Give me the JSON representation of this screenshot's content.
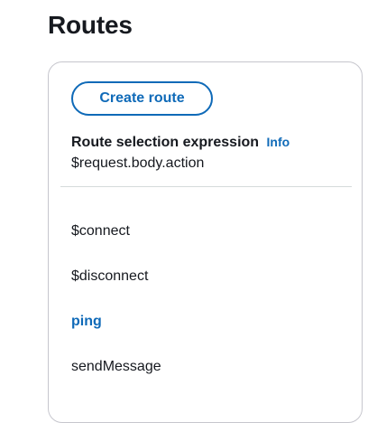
{
  "page": {
    "title": "Routes"
  },
  "panel": {
    "create_button_label": "Create route",
    "route_selection": {
      "label": "Route selection expression",
      "info_link": "Info",
      "value": "$request.body.action"
    },
    "routes": [
      {
        "label": "$connect",
        "selected": false
      },
      {
        "label": "$disconnect",
        "selected": false
      },
      {
        "label": "ping",
        "selected": true
      },
      {
        "label": "sendMessage",
        "selected": false
      }
    ]
  },
  "colors": {
    "accent": "#0f6ab8",
    "text": "#16191f",
    "border": "#c6c6cd"
  }
}
